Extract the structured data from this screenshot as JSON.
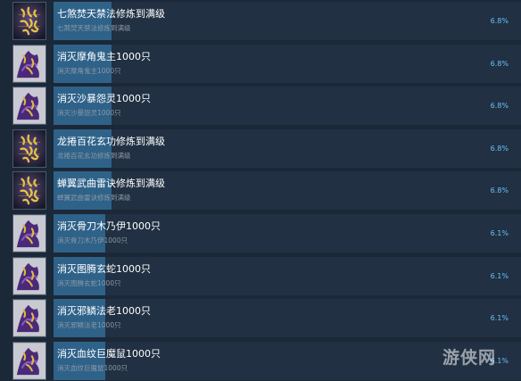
{
  "achievements": [
    {
      "name": "七煞焚天禁法修炼到满级",
      "description": "七煞焚天禁法修炼到满级",
      "percent_text": "6.8%",
      "percent": 6.8,
      "icon": "golden-calligraphy-icon",
      "icon_tone": "gold"
    },
    {
      "name": "消灭摩角鬼主1000只",
      "description": "消灭摩角鬼主1000只",
      "percent_text": "6.8%",
      "percent": 6.8,
      "icon": "purple-demon-icon",
      "icon_tone": "purple"
    },
    {
      "name": "消灭沙暴怨灵1000只",
      "description": "消灭沙暴怨灵1000只",
      "percent_text": "6.8%",
      "percent": 6.8,
      "icon": "purple-demon-icon",
      "icon_tone": "purple"
    },
    {
      "name": "龙捲百花玄功修炼到满级",
      "description": "龙捲百花玄功修炼到满级",
      "percent_text": "6.8%",
      "percent": 6.8,
      "icon": "golden-calligraphy-icon",
      "icon_tone": "gold"
    },
    {
      "name": "蝉翼武曲雷诀修炼到满级",
      "description": "蝉翼武曲雷诀修炼到满级",
      "percent_text": "6.8%",
      "percent": 6.8,
      "icon": "golden-calligraphy-icon",
      "icon_tone": "gold"
    },
    {
      "name": "消灭骨刀木乃伊1000只",
      "description": "消灭骨刀木乃伊1000只",
      "percent_text": "6.1%",
      "percent": 6.1,
      "icon": "purple-demon-icon",
      "icon_tone": "purple"
    },
    {
      "name": "消灭图腾玄蛇1000只",
      "description": "消灭图腾玄蛇1000只",
      "percent_text": "6.1%",
      "percent": 6.1,
      "icon": "purple-demon-icon",
      "icon_tone": "purple"
    },
    {
      "name": "消灭邪鳞法老1000只",
      "description": "消灭邪鳞法老1000只",
      "percent_text": "6.1%",
      "percent": 6.1,
      "icon": "purple-demon-icon",
      "icon_tone": "purple"
    },
    {
      "name": "消灭血纹巨魔鼠1000只",
      "description": "消灭血纹巨魔鼠1000只",
      "percent_text": "6.1%",
      "percent": 6.1,
      "icon": "purple-demon-icon",
      "icon_tone": "purple"
    }
  ],
  "watermark": "游侠网",
  "colors": {
    "background": "#1b2838",
    "bar_background": "#213042",
    "bar_fill": "#2f6289",
    "name_text": "#ffffff",
    "description_text": "#8b98a5",
    "percent_text": "#67c1f5"
  }
}
